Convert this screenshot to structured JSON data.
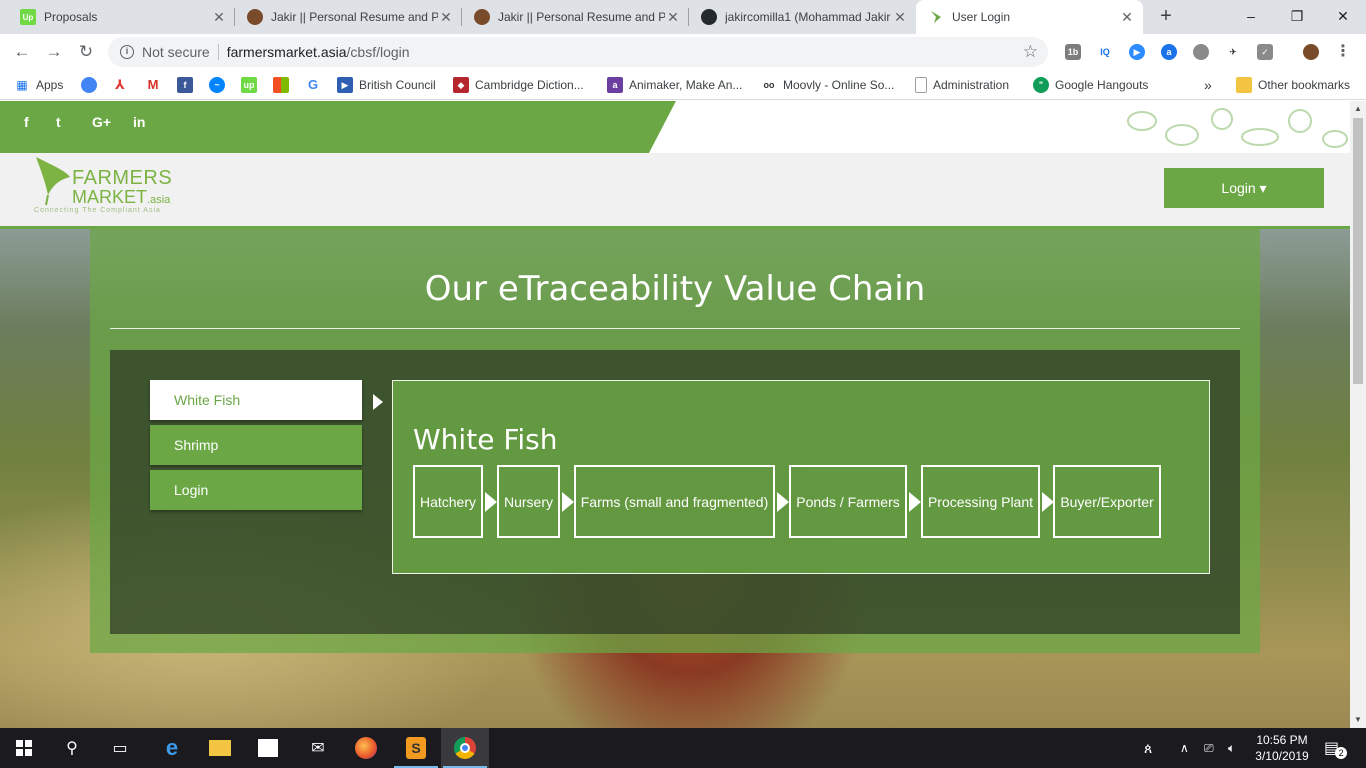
{
  "browser": {
    "tabs": [
      {
        "title": "Proposals",
        "favicon": "upwork-icon",
        "favicon_color": "#6fda44",
        "favicon_text": "Up",
        "active": false
      },
      {
        "title": "Jakir || Personal Resume and Po",
        "favicon": "avatar-icon",
        "favicon_color": "#7a4b2a",
        "favicon_text": "",
        "active": false
      },
      {
        "title": "Jakir || Personal Resume and Po",
        "favicon": "avatar-icon",
        "favicon_color": "#7a4b2a",
        "favicon_text": "",
        "active": false
      },
      {
        "title": "jakircomilla1 (Mohammad Jakir",
        "favicon": "github-icon",
        "favicon_color": "#24292e",
        "favicon_text": "",
        "active": false
      },
      {
        "title": "User Login",
        "favicon": "leaf-icon",
        "favicon_color": "#6ba845",
        "favicon_text": "",
        "active": true
      }
    ],
    "new_tab_label": "+",
    "window_controls": {
      "minimize": "–",
      "maximize": "❐",
      "close": "✕"
    },
    "nav": {
      "back": "←",
      "forward": "→",
      "reload": "↻"
    },
    "omnibox": {
      "security_text": "Not secure",
      "url_host": "farmersmarket.asia",
      "url_path": "/cbsf/login"
    },
    "bookmarks": [
      {
        "label": "Apps",
        "icon": "apps-grid-icon",
        "color": "#1a73e8"
      },
      {
        "label": "",
        "icon": "account-icon",
        "color": "#4285f4"
      },
      {
        "label": "",
        "icon": "acrobat-icon",
        "color": "#e53935"
      },
      {
        "label": "",
        "icon": "gmail-icon",
        "color": "#d93025"
      },
      {
        "label": "",
        "icon": "facebook-icon",
        "color": "#3b5998"
      },
      {
        "label": "",
        "icon": "messenger-icon",
        "color": "#0084ff"
      },
      {
        "label": "",
        "icon": "upwork-icon",
        "color": "#6fda44"
      },
      {
        "label": "",
        "icon": "microsoft-icon",
        "color": "#f25022"
      },
      {
        "label": "",
        "icon": "google-icon",
        "color": "#4285f4"
      },
      {
        "label": "British Council",
        "icon": "play-icon",
        "color": "#2f5fb3"
      },
      {
        "label": "Cambridge Diction...",
        "icon": "cambridge-icon",
        "color": "#b5272d"
      },
      {
        "label": "Animaker, Make An...",
        "icon": "animaker-icon",
        "color": "#6b3fa0"
      },
      {
        "label": "Moovly - Online So...",
        "icon": "moovly-icon",
        "color": "#333333"
      },
      {
        "label": "Administration",
        "icon": "page-icon",
        "color": "#9e9e9e"
      },
      {
        "label": "Google Hangouts",
        "icon": "hangouts-icon",
        "color": "#0f9d58"
      }
    ],
    "bookmarks_overflow": "»",
    "other_bookmarks": "Other bookmarks"
  },
  "site": {
    "social": [
      "f",
      "t",
      "G+",
      "in"
    ],
    "logo": {
      "line1": "FARMERS",
      "line2": "MARKET",
      "line2_suffix": ".asia",
      "tagline": "Connecting The Compliant Asia"
    },
    "login_button": "Login ▾",
    "hero_title": "Our eTraceability Value Chain",
    "side_menu": [
      {
        "label": "White Fish",
        "active": true
      },
      {
        "label": "Shrimp",
        "active": false
      },
      {
        "label": "Login",
        "active": false
      }
    ],
    "chain_title": "White Fish",
    "steps": [
      "Hatchery",
      "Nursery",
      "Farms (small and fragmented)",
      "Ponds / Farmers",
      "Processing Plant",
      "Buyer/Exporter"
    ]
  },
  "taskbar": {
    "time": "10:56 PM",
    "date": "3/10/2019",
    "notification_count": "2",
    "apps": [
      "start-icon",
      "search-icon",
      "task-view-icon",
      "edge-icon",
      "file-explorer-icon",
      "store-icon",
      "mail-icon",
      "firefox-icon",
      "sublime-icon",
      "chrome-icon"
    ],
    "accent": "#76b9ed"
  },
  "colors": {
    "brand_green": "#6ba845",
    "tab_bg": "#dee1e6"
  }
}
